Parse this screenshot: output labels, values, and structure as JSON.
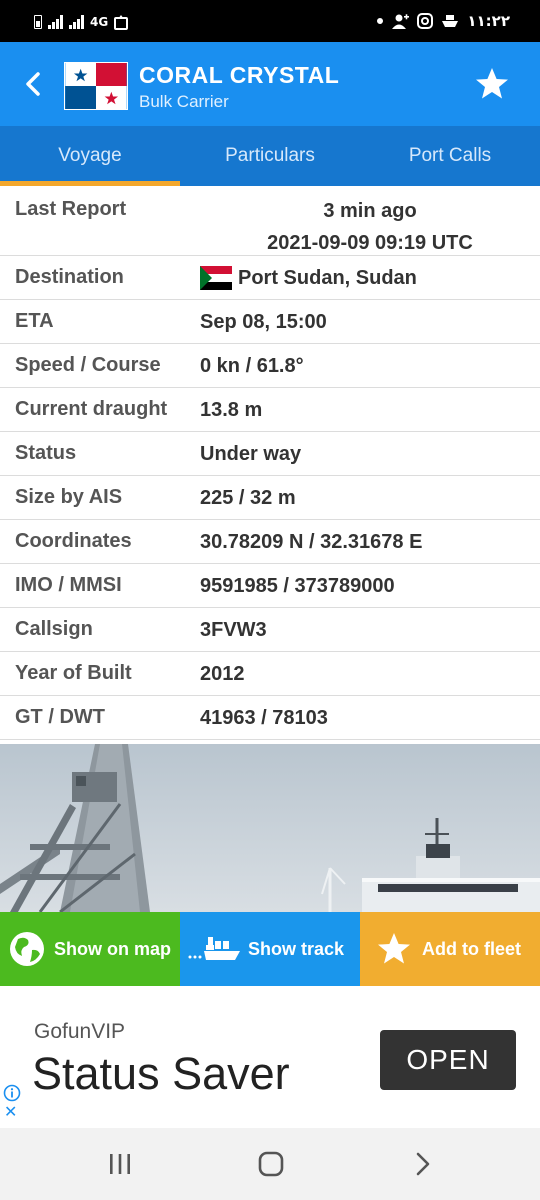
{
  "status_bar": {
    "network": "4G",
    "time": "١١:٢٢"
  },
  "header": {
    "vessel_name": "CORAL CRYSTAL",
    "vessel_type": "Bulk Carrier",
    "flag_icon": "panama-flag-icon"
  },
  "tabs": [
    {
      "label": "Voyage",
      "active": true
    },
    {
      "label": "Particulars",
      "active": false
    },
    {
      "label": "Port Calls",
      "active": false
    }
  ],
  "details": {
    "last_report": {
      "label": "Last Report",
      "relative": "3 min ago",
      "timestamp": "2021-09-09 09:19 UTC"
    },
    "destination": {
      "label": "Destination",
      "value": "Port Sudan, Sudan",
      "flag_icon": "sudan-flag-icon"
    },
    "eta": {
      "label": "ETA",
      "value": "Sep 08, 15:00"
    },
    "speed_course": {
      "label": "Speed / Course",
      "value": "0 kn / 61.8°"
    },
    "draught": {
      "label": "Current draught",
      "value": "13.8 m"
    },
    "status": {
      "label": "Status",
      "value": "Under way"
    },
    "size": {
      "label": "Size by AIS",
      "value": "225 / 32 m"
    },
    "coordinates": {
      "label": "Coordinates",
      "value": "30.78209 N / 32.31678 E"
    },
    "imo_mmsi": {
      "label": "IMO / MMSI",
      "value": "9591985 / 373789000"
    },
    "callsign": {
      "label": "Callsign",
      "value": "3FVW3"
    },
    "year_built": {
      "label": "Year of Built",
      "value": "2012"
    },
    "gt_dwt": {
      "label": "GT / DWT",
      "value": "41963 / 78103"
    }
  },
  "actions": {
    "show_on_map": "Show on map",
    "show_track": "Show track",
    "add_to_fleet": "Add to fleet"
  },
  "ad": {
    "brand": "GofunVIP",
    "title": "Status Saver",
    "cta": "OPEN"
  },
  "colors": {
    "header_blue": "#1a8ff0",
    "tab_blue": "#1677cf",
    "tab_indicator": "#f3a72c",
    "map_green": "#4cba1f",
    "track_blue": "#1a96ec",
    "fleet_orange": "#f1ad30"
  }
}
